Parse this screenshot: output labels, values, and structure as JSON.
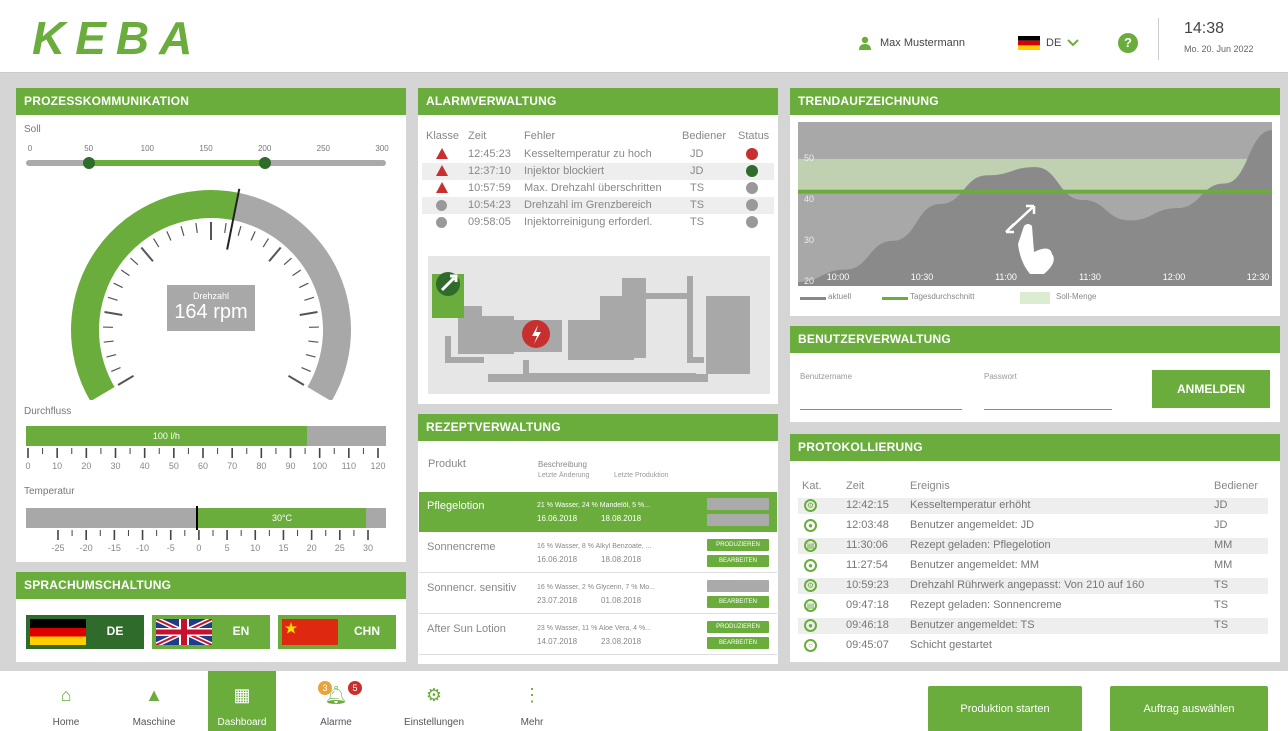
{
  "header": {
    "logo": "KEBA",
    "user_name": "Max Mustermann",
    "language": "DE",
    "help": "?",
    "time": "14:38",
    "date": "Mo. 20. Jun 2022"
  },
  "process": {
    "title": "PROZESSKOMMUNIKATION",
    "soll_label": "Soll",
    "soll_ticks": [
      "0",
      "50",
      "100",
      "150",
      "200",
      "250",
      "300"
    ],
    "soll_range": [
      50,
      200
    ],
    "gauge_label": "Drehzahl",
    "gauge_value": "164 rpm",
    "gauge_fraction": 0.547,
    "flow_label": "Durchfluss",
    "flow_value": "100 l/h",
    "flow_fraction": 0.78,
    "flow_ticks": [
      "0",
      "10",
      "20",
      "30",
      "40",
      "50",
      "60",
      "70",
      "80",
      "90",
      "100",
      "110",
      "120"
    ],
    "temp_label": "Temperatur",
    "temp_value": "30°C",
    "temp_ticks": [
      "-25",
      "-20",
      "-15",
      "-10",
      "-5",
      "0",
      "5",
      "10",
      "15",
      "20",
      "25",
      "30"
    ]
  },
  "language_switch": {
    "title": "SPRACHUMSCHALTUNG",
    "buttons": [
      {
        "label": "DE"
      },
      {
        "label": "EN"
      },
      {
        "label": "CHN"
      }
    ]
  },
  "alarms": {
    "title": "ALARMVERWALTUNG",
    "headers": {
      "klasse": "Klasse",
      "zeit": "Zeit",
      "fehler": "Fehler",
      "bediener": "Bediener",
      "status": "Status"
    },
    "rows": [
      {
        "time": "12:45:23",
        "error": "Kesseltemperatur zu hoch",
        "operator": "JD"
      },
      {
        "time": "12:37:10",
        "error": "Injektor blockiert",
        "operator": "JD"
      },
      {
        "time": "10:57:59",
        "error": "Max. Drehzahl überschritten",
        "operator": "TS"
      },
      {
        "time": "10:54:23",
        "error": "Drehzahl im Grenzbereich",
        "operator": "TS"
      },
      {
        "time": "09:58:05",
        "error": "Injektorreinigung erforderl.",
        "operator": "TS"
      }
    ]
  },
  "recipes": {
    "title": "REZEPTVERWALTUNG",
    "header_product": "Produkt",
    "header_desc": "Beschreibung",
    "header_change": "Letzte Änderung",
    "header_prod": "Letzte Produktion",
    "rows": [
      {
        "name": "Pflegelotion",
        "desc": "21 % Wasser, 24 % Mandelöl, 5 %...",
        "changed": "16.06.2018",
        "produced": "18.08.2018"
      },
      {
        "name": "Sonnencreme",
        "desc": "16 % Wasser, 8 % Alkyl Benzoate, ...",
        "changed": "16.06.2018",
        "produced": "18.08.2018"
      },
      {
        "name": "Sonnencr. sensitiv",
        "desc": "16 % Wasser, 2 % Glycerin, 7 % Mo...",
        "changed": "23.07.2018",
        "produced": "01.08.2018"
      },
      {
        "name": "After Sun Lotion",
        "desc": "23 % Wasser, 11 % Aloe Vera, 4 %...",
        "changed": "14.07.2018",
        "produced": "23.08.2018"
      }
    ],
    "btn_produce": "PRODUZIEREN",
    "btn_edit": "BEARBEITEN"
  },
  "trend": {
    "title": "TRENDAUFZEICHNUNG",
    "legend_actual": "aktuell",
    "legend_avg": "Tagesdurchschnitt",
    "legend_target": "Soll-Menge"
  },
  "chart_data": {
    "type": "area",
    "x": [
      "10:00",
      "10:30",
      "11:00",
      "11:30",
      "12:00",
      "12:30"
    ],
    "x_extra": [
      "10:00",
      "10:15",
      "10:30",
      "10:45",
      "11:00",
      "11:15",
      "11:30",
      "11:45",
      "12:00",
      "12:15",
      "12:30"
    ],
    "y": [
      21,
      24,
      31,
      40,
      47,
      49,
      41,
      36,
      39,
      45,
      58
    ],
    "avg": 43,
    "target_range": [
      43,
      51
    ],
    "y_ticks": [
      "20",
      "30",
      "40",
      "50"
    ],
    "ylim": [
      20,
      60
    ],
    "series": [
      {
        "name": "aktuell"
      },
      {
        "name": "Tagesdurchschnitt"
      },
      {
        "name": "Soll-Menge"
      }
    ]
  },
  "users": {
    "title": "BENUTZERVERWALTUNG",
    "user_label": "Benutzername",
    "pass_label": "Passwort",
    "login": "ANMELDEN"
  },
  "protocol": {
    "title": "PROTOKOLLIERUNG",
    "headers": {
      "kat": "Kat.",
      "zeit": "Zeit",
      "ereignis": "Ereignis",
      "bediener": "Bediener"
    },
    "rows": [
      {
        "icon": "gear",
        "time": "12:42:15",
        "event": "Kesseltemperatur erhöht",
        "operator": "JD"
      },
      {
        "icon": "user",
        "time": "12:03:48",
        "event": "Benutzer angemeldet: JD",
        "operator": "JD"
      },
      {
        "icon": "doc",
        "time": "11:30:06",
        "event": "Rezept geladen: Pflegelotion",
        "operator": "MM"
      },
      {
        "icon": "user",
        "time": "11:27:54",
        "event": "Benutzer angemeldet: MM",
        "operator": "MM"
      },
      {
        "icon": "gear",
        "time": "10:59:23",
        "event": "Drehzahl Rührwerk angepasst: Von 210 auf 160",
        "operator": "TS"
      },
      {
        "icon": "doc",
        "time": "09:47:18",
        "event": "Rezept geladen: Sonnencreme",
        "operator": "TS"
      },
      {
        "icon": "user",
        "time": "09:46:18",
        "event": "Benutzer angemeldet: TS",
        "operator": "TS"
      },
      {
        "icon": "circle",
        "time": "09:45:07",
        "event": "Schicht gestartet",
        "operator": ""
      }
    ]
  },
  "nav": {
    "items": [
      {
        "label": "Home"
      },
      {
        "label": "Maschine"
      },
      {
        "label": "Dashboard"
      },
      {
        "label": "Alarme"
      },
      {
        "label": "Einstellungen"
      },
      {
        "label": "Mehr"
      }
    ],
    "alarm_badge_1": "3",
    "alarm_badge_2": "5",
    "btn_start": "Produktion starten",
    "btn_order": "Auftrag auswählen"
  },
  "colors": {
    "accent": "#6aad3c",
    "dark_green": "#2f6b2a",
    "gray": "#a8a8a8",
    "alarm_red": "#c8302f"
  }
}
